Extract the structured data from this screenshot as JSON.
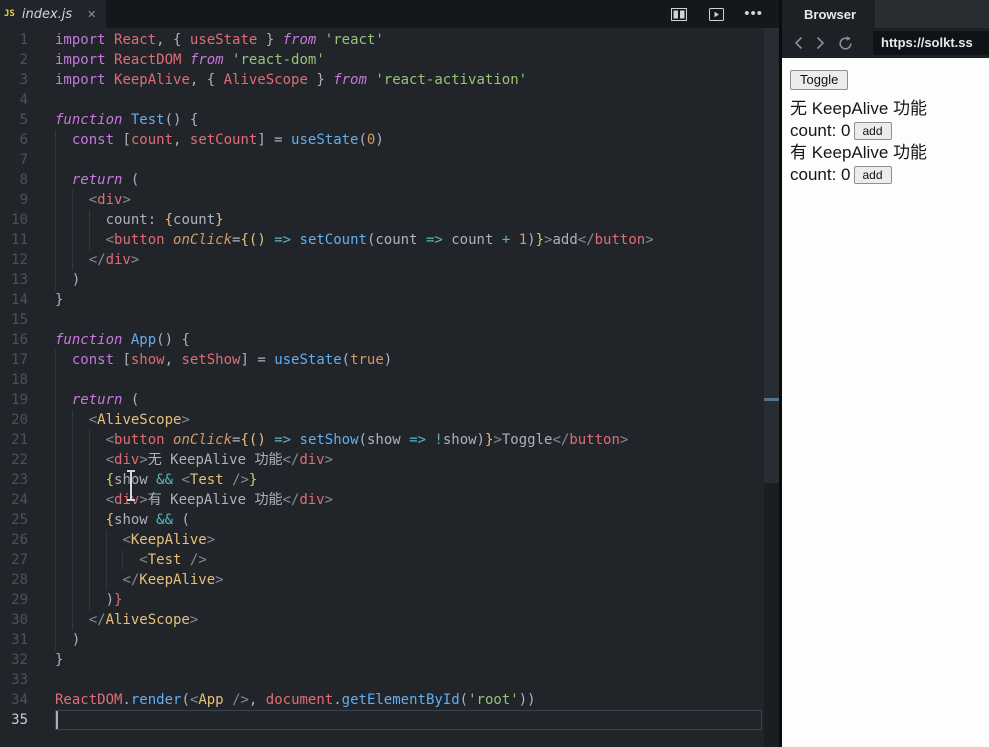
{
  "editor": {
    "tab": {
      "filename": "index.js",
      "file_icon": "JS",
      "close_glyph": "✕"
    },
    "topbar_icons": {
      "split": "split-editor-icon",
      "preview": "open-preview-icon",
      "more": "more-options-icon",
      "more_glyph": "•••"
    },
    "lines": [
      {
        "n": 1,
        "t": [
          [
            "k",
            "import"
          ],
          [
            "d",
            " "
          ],
          [
            "v",
            "React"
          ],
          [
            "d",
            ", { "
          ],
          [
            "v",
            "useState"
          ],
          [
            "d",
            " } "
          ],
          [
            "i",
            "from"
          ],
          [
            "d",
            " "
          ],
          [
            "s",
            "'react'"
          ]
        ]
      },
      {
        "n": 2,
        "t": [
          [
            "k",
            "import"
          ],
          [
            "d",
            " "
          ],
          [
            "v",
            "ReactDOM"
          ],
          [
            "d",
            " "
          ],
          [
            "i",
            "from"
          ],
          [
            "d",
            " "
          ],
          [
            "s",
            "'react-dom'"
          ]
        ]
      },
      {
        "n": 3,
        "t": [
          [
            "k",
            "import"
          ],
          [
            "d",
            " "
          ],
          [
            "v",
            "KeepAlive"
          ],
          [
            "d",
            ", { "
          ],
          [
            "v",
            "AliveScope"
          ],
          [
            "d",
            " } "
          ],
          [
            "i",
            "from"
          ],
          [
            "d",
            " "
          ],
          [
            "s",
            "'react-activation'"
          ]
        ]
      },
      {
        "n": 4,
        "t": [],
        "g": 0
      },
      {
        "n": 5,
        "t": [
          [
            "i",
            "function"
          ],
          [
            "d",
            " "
          ],
          [
            "f",
            "Test"
          ],
          [
            "d",
            "() {"
          ]
        ]
      },
      {
        "n": 6,
        "t": [
          [
            "d",
            "  "
          ],
          [
            "k",
            "const"
          ],
          [
            "d",
            " ["
          ],
          [
            "v",
            "count"
          ],
          [
            "d",
            ", "
          ],
          [
            "v",
            "setCount"
          ],
          [
            "d",
            "] = "
          ],
          [
            "f",
            "useState"
          ],
          [
            "d",
            "("
          ],
          [
            "n2",
            "0"
          ],
          [
            "d",
            ")"
          ]
        ]
      },
      {
        "n": 7,
        "t": [],
        "g": 1
      },
      {
        "n": 8,
        "t": [
          [
            "d",
            "  "
          ],
          [
            "i",
            "return"
          ],
          [
            "d",
            " ("
          ]
        ]
      },
      {
        "n": 9,
        "t": [
          [
            "d",
            "    "
          ],
          [
            "p",
            "<"
          ],
          [
            "t",
            "div"
          ],
          [
            "p",
            ">"
          ]
        ]
      },
      {
        "n": 10,
        "t": [
          [
            "d",
            "      count: "
          ],
          [
            "b",
            "{"
          ],
          [
            "d",
            "count"
          ],
          [
            "b",
            "}"
          ]
        ]
      },
      {
        "n": 11,
        "t": [
          [
            "d",
            "      "
          ],
          [
            "p",
            "<"
          ],
          [
            "t",
            "button"
          ],
          [
            "d",
            " "
          ],
          [
            "a",
            "onClick"
          ],
          [
            "d",
            "="
          ],
          [
            "b",
            "{()"
          ],
          [
            "d",
            " "
          ],
          [
            "o",
            "=>"
          ],
          [
            "d",
            " "
          ],
          [
            "f",
            "setCount"
          ],
          [
            "d",
            "(count "
          ],
          [
            "o",
            "=>"
          ],
          [
            "d",
            " count "
          ],
          [
            "o",
            "+"
          ],
          [
            "d",
            " "
          ],
          [
            "n2",
            "1"
          ],
          [
            "d",
            ")"
          ],
          [
            "b",
            "}"
          ],
          [
            "p",
            ">"
          ],
          [
            "d",
            "add"
          ],
          [
            "p",
            "</"
          ],
          [
            "t",
            "button"
          ],
          [
            "p",
            ">"
          ]
        ]
      },
      {
        "n": 12,
        "t": [
          [
            "d",
            "    "
          ],
          [
            "p",
            "</"
          ],
          [
            "t",
            "div"
          ],
          [
            "p",
            ">"
          ]
        ]
      },
      {
        "n": 13,
        "t": [
          [
            "d",
            "  )"
          ]
        ]
      },
      {
        "n": 14,
        "t": [
          [
            "d",
            "}"
          ]
        ]
      },
      {
        "n": 15,
        "t": [],
        "g": 0
      },
      {
        "n": 16,
        "t": [
          [
            "i",
            "function"
          ],
          [
            "d",
            " "
          ],
          [
            "f",
            "App"
          ],
          [
            "d",
            "() {"
          ]
        ]
      },
      {
        "n": 17,
        "t": [
          [
            "d",
            "  "
          ],
          [
            "k",
            "const"
          ],
          [
            "d",
            " ["
          ],
          [
            "v",
            "show"
          ],
          [
            "d",
            ", "
          ],
          [
            "v",
            "setShow"
          ],
          [
            "d",
            "] = "
          ],
          [
            "f",
            "useState"
          ],
          [
            "d",
            "("
          ],
          [
            "n2",
            "true"
          ],
          [
            "d",
            ")"
          ]
        ]
      },
      {
        "n": 18,
        "t": [],
        "g": 1
      },
      {
        "n": 19,
        "t": [
          [
            "d",
            "  "
          ],
          [
            "i",
            "return"
          ],
          [
            "d",
            " ("
          ]
        ]
      },
      {
        "n": 20,
        "t": [
          [
            "d",
            "    "
          ],
          [
            "p",
            "<"
          ],
          [
            "c",
            "AliveScope"
          ],
          [
            "p",
            ">"
          ]
        ]
      },
      {
        "n": 21,
        "t": [
          [
            "d",
            "      "
          ],
          [
            "p",
            "<"
          ],
          [
            "t",
            "button"
          ],
          [
            "d",
            " "
          ],
          [
            "a",
            "onClick"
          ],
          [
            "d",
            "="
          ],
          [
            "b",
            "{()"
          ],
          [
            "d",
            " "
          ],
          [
            "o",
            "=>"
          ],
          [
            "d",
            " "
          ],
          [
            "f",
            "setShow"
          ],
          [
            "d",
            "(show "
          ],
          [
            "o",
            "=>"
          ],
          [
            "d",
            " "
          ],
          [
            "o",
            "!"
          ],
          [
            "d",
            "show)"
          ],
          [
            "b",
            "}"
          ],
          [
            "p",
            ">"
          ],
          [
            "d",
            "Toggle"
          ],
          [
            "p",
            "</"
          ],
          [
            "t",
            "button"
          ],
          [
            "p",
            ">"
          ]
        ]
      },
      {
        "n": 22,
        "t": [
          [
            "d",
            "      "
          ],
          [
            "p",
            "<"
          ],
          [
            "t",
            "div"
          ],
          [
            "p",
            ">"
          ],
          [
            "d",
            "无 KeepAlive 功能"
          ],
          [
            "p",
            "</"
          ],
          [
            "t",
            "div"
          ],
          [
            "p",
            ">"
          ]
        ]
      },
      {
        "n": 23,
        "t": [
          [
            "d",
            "      "
          ],
          [
            "b",
            "{"
          ],
          [
            "d",
            "show "
          ],
          [
            "o",
            "&&"
          ],
          [
            "d",
            " "
          ],
          [
            "p",
            "<"
          ],
          [
            "c",
            "Test"
          ],
          [
            "d",
            " "
          ],
          [
            "p",
            "/>"
          ],
          [
            "b",
            "}"
          ]
        ]
      },
      {
        "n": 24,
        "t": [
          [
            "d",
            "      "
          ],
          [
            "p",
            "<"
          ],
          [
            "t",
            "div"
          ],
          [
            "p",
            ">"
          ],
          [
            "d",
            "有 KeepAlive 功能"
          ],
          [
            "p",
            "</"
          ],
          [
            "t",
            "div"
          ],
          [
            "p",
            ">"
          ]
        ]
      },
      {
        "n": 25,
        "t": [
          [
            "d",
            "      "
          ],
          [
            "b",
            "{"
          ],
          [
            "d",
            "show "
          ],
          [
            "o",
            "&&"
          ],
          [
            "d",
            " ("
          ]
        ]
      },
      {
        "n": 26,
        "t": [
          [
            "d",
            "        "
          ],
          [
            "p",
            "<"
          ],
          [
            "c",
            "KeepAlive"
          ],
          [
            "p",
            ">"
          ]
        ]
      },
      {
        "n": 27,
        "t": [
          [
            "d",
            "          "
          ],
          [
            "p",
            "<"
          ],
          [
            "c",
            "Test"
          ],
          [
            "d",
            " "
          ],
          [
            "p",
            "/>"
          ]
        ]
      },
      {
        "n": 28,
        "t": [
          [
            "d",
            "        "
          ],
          [
            "p",
            "</"
          ],
          [
            "c",
            "KeepAlive"
          ],
          [
            "p",
            ">"
          ]
        ]
      },
      {
        "n": 29,
        "t": [
          [
            "d",
            "      )"
          ],
          [
            "v",
            "}"
          ]
        ]
      },
      {
        "n": 30,
        "t": [
          [
            "d",
            "    "
          ],
          [
            "p",
            "</"
          ],
          [
            "c",
            "AliveScope"
          ],
          [
            "p",
            ">"
          ]
        ]
      },
      {
        "n": 31,
        "t": [
          [
            "d",
            "  )"
          ]
        ]
      },
      {
        "n": 32,
        "t": [
          [
            "d",
            "}"
          ]
        ]
      },
      {
        "n": 33,
        "t": [],
        "g": 0
      },
      {
        "n": 34,
        "t": [
          [
            "v",
            "ReactDOM"
          ],
          [
            "d",
            "."
          ],
          [
            "f",
            "render"
          ],
          [
            "d",
            "("
          ],
          [
            "p",
            "<"
          ],
          [
            "c",
            "App"
          ],
          [
            "d",
            " "
          ],
          [
            "p",
            "/>"
          ],
          [
            "d",
            ", "
          ],
          [
            "v",
            "document"
          ],
          [
            "d",
            "."
          ],
          [
            "f",
            "getElementById"
          ],
          [
            "d",
            "("
          ],
          [
            "s",
            "'root'"
          ],
          [
            "d",
            "))"
          ]
        ]
      },
      {
        "n": 35,
        "t": [],
        "g": 0,
        "cur": true
      }
    ]
  },
  "browser": {
    "tab_label": "Browser",
    "nav": {
      "back_icon": "back-chevron",
      "forward_icon": "forward-chevron",
      "refresh_icon": "refresh-arrow",
      "url": "https://solkt.ss"
    },
    "preview": {
      "rows": [
        {
          "type": "button",
          "label": "Toggle"
        },
        {
          "type": "text",
          "text": "无 KeepAlive 功能"
        },
        {
          "type": "count",
          "text": "count: 0",
          "button": "add"
        },
        {
          "type": "text",
          "text": "有 KeepAlive 功能"
        },
        {
          "type": "count",
          "text": "count: 0",
          "button": "add"
        }
      ]
    }
  },
  "palette": {
    "editor_bg": "#21252a",
    "topbar_bg": "#14171b",
    "keyword": "#c678dd",
    "variable": "#e06c75",
    "function": "#61afef",
    "string": "#98c379",
    "number": "#d19a66",
    "operator": "#56b6c2",
    "component": "#e5c07b",
    "default_text": "#abb2bf",
    "line_number": "#4a5262",
    "scroll_marker": "#4d7596",
    "preview_bg": "#ffffff"
  }
}
